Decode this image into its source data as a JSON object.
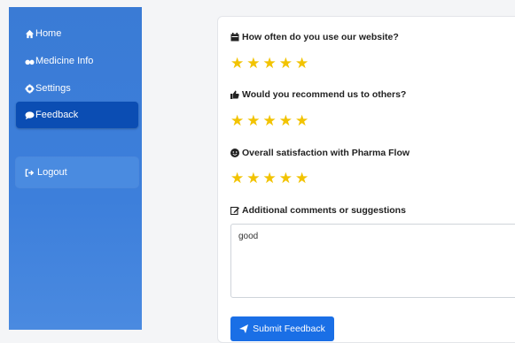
{
  "sidebar": {
    "items": [
      {
        "label": "Home",
        "icon": "home-icon"
      },
      {
        "label": "Medicine Info",
        "icon": "pills-icon"
      },
      {
        "label": "Settings",
        "icon": "gear-icon"
      },
      {
        "label": "Feedback",
        "icon": "comment-icon",
        "active": true
      }
    ],
    "logout_label": "Logout"
  },
  "feedback": {
    "questions": [
      {
        "label": "How often do you use our website?",
        "icon": "calendar-icon",
        "rating": 5,
        "max": 5
      },
      {
        "label": "Would you recommend us to others?",
        "icon": "thumbs-up-icon",
        "rating": 5,
        "max": 5
      },
      {
        "label": "Overall satisfaction with Pharma Flow",
        "icon": "smile-icon",
        "rating": 5,
        "max": 5
      }
    ],
    "comments_label": "Additional comments or suggestions",
    "comments_value": "good",
    "submit_label": "Submit Feedback"
  },
  "colors": {
    "sidebar": "#3a7bd5",
    "active": "#0b4db3",
    "star": "#f2c300",
    "submit": "#1a6fe6"
  }
}
